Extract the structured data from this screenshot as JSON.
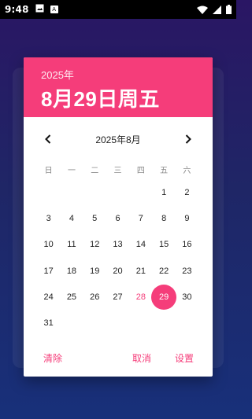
{
  "status_bar": {
    "time": "9:48",
    "icons": [
      "image-icon",
      "a-box-icon",
      "wifi-icon",
      "signal-icon",
      "battery-icon"
    ],
    "a_icon_glyph": "A"
  },
  "dialog": {
    "header": {
      "year": "2025年",
      "date": "8月29日周五"
    },
    "month_title": "2025年8月",
    "weekdays": [
      "日",
      "一",
      "二",
      "三",
      "四",
      "五",
      "六"
    ],
    "days": [
      "",
      "",
      "",
      "",
      "",
      "1",
      "2",
      "3",
      "4",
      "5",
      "6",
      "7",
      "8",
      "9",
      "10",
      "11",
      "12",
      "13",
      "14",
      "15",
      "16",
      "17",
      "18",
      "19",
      "20",
      "21",
      "22",
      "23",
      "24",
      "25",
      "26",
      "27",
      "28",
      "29",
      "30",
      "31"
    ],
    "today": "28",
    "selected": "29",
    "actions": {
      "clear": "清除",
      "cancel": "取消",
      "ok": "设置"
    }
  },
  "colors": {
    "accent": "#f53d7a",
    "background_top": "#2a1664",
    "background_bottom": "#18307a"
  }
}
